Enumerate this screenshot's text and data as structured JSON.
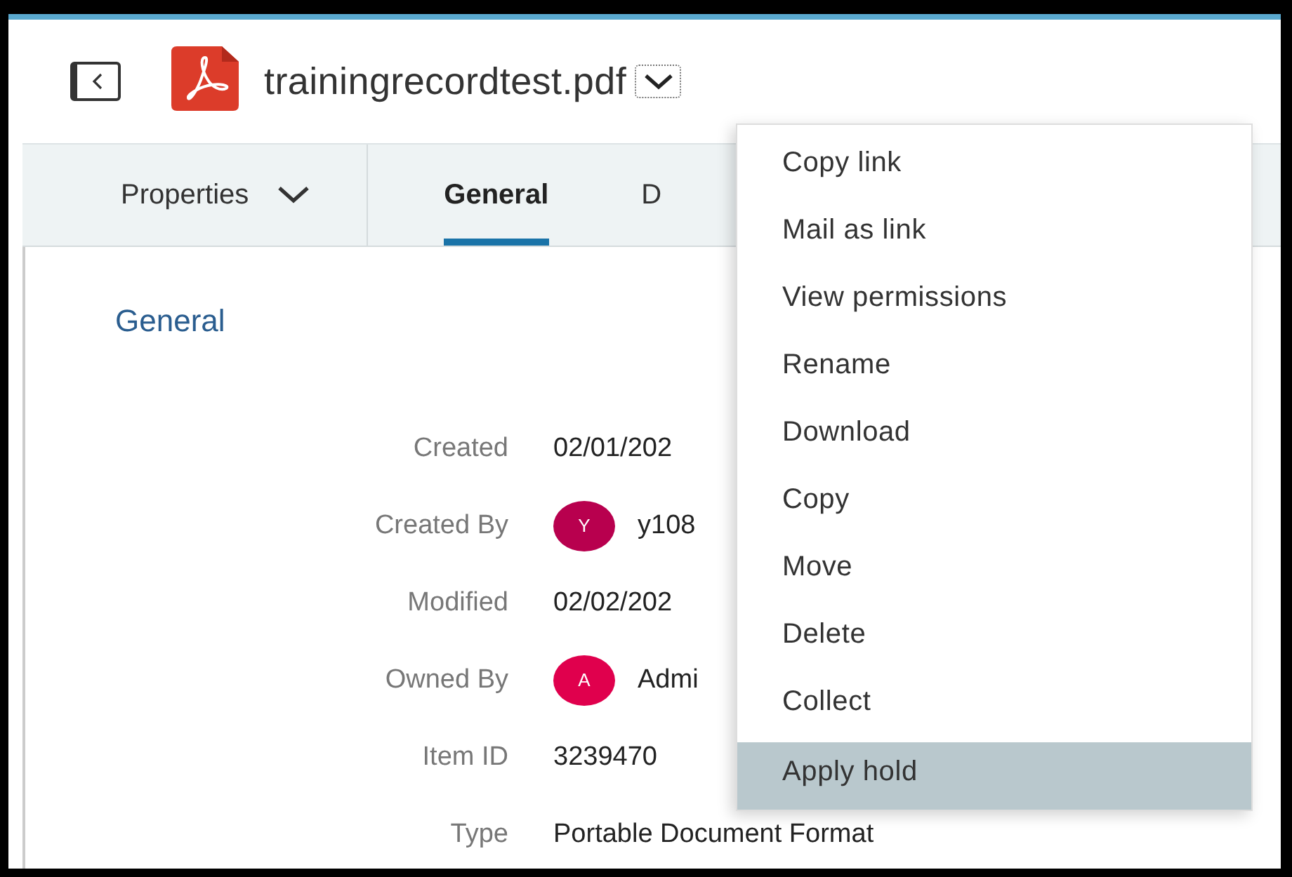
{
  "header": {
    "title": "trainingrecordtest.pdf"
  },
  "tabs": [
    {
      "label": "Properties",
      "kind": "dropdown",
      "selected": false
    },
    {
      "label": "General",
      "kind": "tab",
      "selected": true
    },
    {
      "label": "D",
      "kind": "tab",
      "selected": false
    }
  ],
  "section": {
    "heading": "General"
  },
  "fields": [
    {
      "label": "Created",
      "value": "02/01/202"
    },
    {
      "label": "Created By",
      "value": "y108",
      "avatar": "Y",
      "color": "#b8004e"
    },
    {
      "label": "Modified",
      "value": "02/02/202"
    },
    {
      "label": "Owned By",
      "value": "Admi",
      "avatar": "A",
      "color": "#e0004d"
    },
    {
      "label": "Item ID",
      "value": "3239470"
    },
    {
      "label": "Type",
      "value": "Portable Document Format"
    }
  ],
  "menu": {
    "items": [
      {
        "label": "Copy link",
        "selected": false
      },
      {
        "label": "Mail as link",
        "selected": false
      },
      {
        "label": "View permissions",
        "selected": false
      },
      {
        "label": "Rename",
        "selected": false
      },
      {
        "label": "Download",
        "selected": false
      },
      {
        "label": "Copy",
        "selected": false
      },
      {
        "label": "Move",
        "selected": false
      },
      {
        "label": "Delete",
        "selected": false
      },
      {
        "label": "Collect",
        "selected": false
      },
      {
        "label": "Apply hold",
        "selected": true
      }
    ]
  }
}
